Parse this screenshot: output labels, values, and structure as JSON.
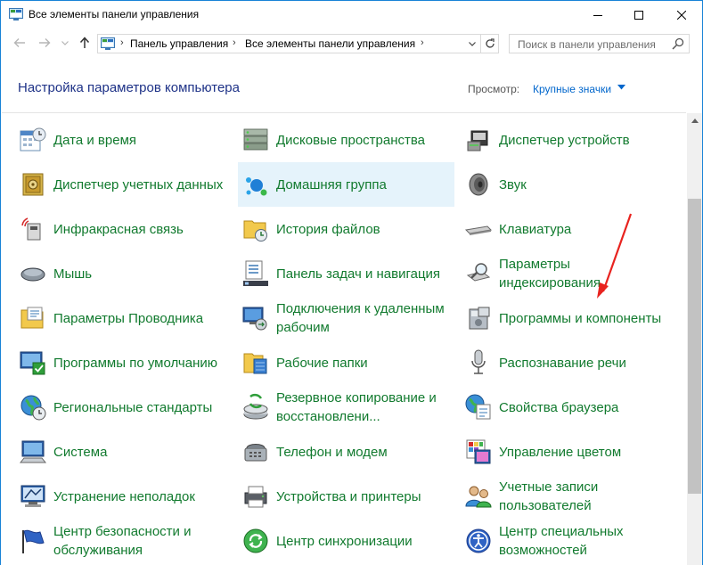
{
  "window": {
    "title": "Все элементы панели управления",
    "icon": "control-panel-icon",
    "buttons": [
      "minimize-icon",
      "maximize-icon",
      "close-icon"
    ]
  },
  "address": {
    "segments": [
      "Панель управления",
      "Все элементы панели управления"
    ],
    "search_placeholder": "Поиск в панели управления"
  },
  "header": {
    "title": "Настройка параметров компьютера",
    "view_label": "Просмотр:",
    "view_value": "Крупные значки"
  },
  "colors": {
    "link_green": "#117a2e",
    "heading_blue": "#1e3287",
    "accent": "#0066cc",
    "hover_bg": "#e5f3fb",
    "annotation_arrow": "#e8231f"
  },
  "items": [
    {
      "label": "Дата и время",
      "icon": "calendar-clock-icon"
    },
    {
      "label": "Дисковые пространства",
      "icon": "storage-spaces-icon"
    },
    {
      "label": "Диспетчер устройств",
      "icon": "device-manager-icon"
    },
    {
      "label": "Диспетчер учетных данных",
      "icon": "credential-vault-icon"
    },
    {
      "label": "Домашняя группа",
      "icon": "homegroup-icon"
    },
    {
      "label": "Звук",
      "icon": "speaker-icon"
    },
    {
      "label": "Инфракрасная связь",
      "icon": "infrared-icon"
    },
    {
      "label": "История файлов",
      "icon": "file-history-icon"
    },
    {
      "label": "Клавиатура",
      "icon": "keyboard-icon"
    },
    {
      "label": "Мышь",
      "icon": "mouse-icon"
    },
    {
      "label": "Панель задач и навигация",
      "icon": "taskbar-icon"
    },
    {
      "label": "Параметры индексирования",
      "icon": "indexing-icon"
    },
    {
      "label": "Параметры Проводника",
      "icon": "folder-options-icon"
    },
    {
      "label": "Подключения к удаленным рабочим",
      "icon": "remote-desktop-icon"
    },
    {
      "label": "Программы и компоненты",
      "icon": "programs-features-icon"
    },
    {
      "label": "Программы по умолчанию",
      "icon": "default-programs-icon"
    },
    {
      "label": "Рабочие папки",
      "icon": "work-folders-icon"
    },
    {
      "label": "Распознавание речи",
      "icon": "microphone-icon"
    },
    {
      "label": "Региональные стандарты",
      "icon": "region-globe-icon"
    },
    {
      "label": "Резервное копирование и восстановлени...",
      "icon": "backup-restore-icon"
    },
    {
      "label": "Свойства браузера",
      "icon": "internet-options-icon"
    },
    {
      "label": "Система",
      "icon": "system-monitor-icon"
    },
    {
      "label": "Телефон и модем",
      "icon": "phone-modem-icon"
    },
    {
      "label": "Управление цветом",
      "icon": "color-management-icon"
    },
    {
      "label": "Устранение неполадок",
      "icon": "troubleshooting-icon"
    },
    {
      "label": "Устройства и принтеры",
      "icon": "devices-printers-icon"
    },
    {
      "label": "Учетные записи пользователей",
      "icon": "user-accounts-icon"
    },
    {
      "label": "Центр безопасности и обслуживания",
      "icon": "security-flag-icon"
    },
    {
      "label": "Центр синхронизации",
      "icon": "sync-center-icon"
    },
    {
      "label": "Центр специальных возможностей",
      "icon": "ease-of-access-icon"
    }
  ]
}
